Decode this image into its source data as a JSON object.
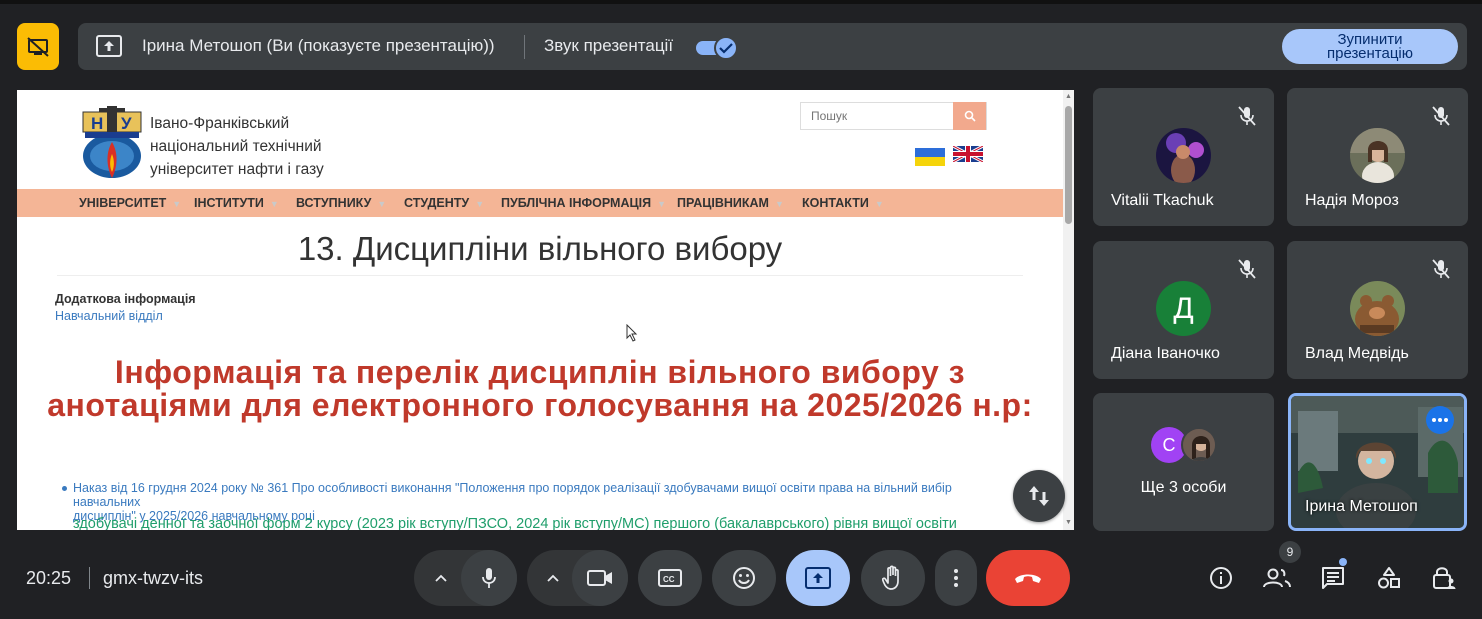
{
  "presentation_bar": {
    "presenter_text": "Ірина Метошоп (Ви (показуєте презентацію))",
    "sound_label": "Звук презентації",
    "sound_on": true,
    "stop_line1": "Зупинити",
    "stop_line2": "презентацію"
  },
  "website": {
    "uni_line1": "Івано-Франківський",
    "uni_line2": "національний технічний",
    "uni_line3": "університет нафти і газу",
    "logo_letters": [
      "Н",
      "У"
    ],
    "search_placeholder": "Пошук",
    "nav": [
      {
        "label": "УНІВЕРСИТЕТ",
        "arrow": "▼"
      },
      {
        "label": "ІНСТИТУТИ",
        "arrow": "▼"
      },
      {
        "label": "ВСТУПНИКУ",
        "arrow": "▼"
      },
      {
        "label": "СТУДЕНТУ",
        "arrow": "▼"
      },
      {
        "label": "ПУБЛІЧНА ІНФОРМАЦІЯ",
        "arrow": "▼"
      },
      {
        "label": "ПРАЦІВНИКАМ",
        "arrow": "▼"
      },
      {
        "label": "КОНТАКТИ",
        "arrow": "▼"
      }
    ],
    "page_title": "13. Дисципліни вільного вибору",
    "additional_info": "Додаткова інформація",
    "department": "Навчальний відділ",
    "heading_line1": "Інформація та перелік дисциплін вільного вибору з",
    "heading_line2": "анотаціями для електронного голосування на 2025/2026 н.р:",
    "order_line1": "Наказ від 16 грудня 2024 року № 361 Про особливості виконання \"Положення про порядок реалізації здобувачами вищої освіти права на вільний вибір навчальних",
    "order_line2": "дисциплін\" у 2025/2026 навчальному році",
    "green_text": "здобувачі денної та заочної форм 2 курсу (2023 рік вступу/ПЗСО, 2024 рік вступу/МС) першого (бакалаврського) рівня вищої освіти"
  },
  "participants": [
    {
      "name": "Vitalii Tkachuk",
      "muted": true
    },
    {
      "name": "Надія Мороз",
      "muted": true
    },
    {
      "name": "Діана Іваночко",
      "muted": true,
      "initial": "Д"
    },
    {
      "name": "Влад Медвідь",
      "muted": true
    }
  ],
  "others": {
    "label": "Ще 3 особи",
    "initial": "С"
  },
  "self": {
    "name": "Ірина Метошоп"
  },
  "bottom_bar": {
    "time": "20:25",
    "meeting_code": "gmx-twzv-its",
    "people_count": "9"
  },
  "colors": {
    "background": "#202124",
    "tile": "#3c4043",
    "accent_blue": "#8ab4f8",
    "share_active": "#a8c7fa",
    "end_call": "#ea4335",
    "present_icon": "#fbbc04",
    "site_nav": "#f4b596",
    "site_heading_red": "#c0392b",
    "site_link_blue": "#3a7abf",
    "site_green": "#1f9e6b"
  },
  "icons": {
    "present_status": "stop-presenting-monitor-icon",
    "share": "present-to-all-icon",
    "mute": "mic-off-icon",
    "swap": "swap-vertical-icon",
    "mic": "mic-icon",
    "camera": "videocam-icon",
    "captions": "closed-caption-icon",
    "reactions": "emoji-icon",
    "present": "present-screen-icon",
    "raise_hand": "hand-icon",
    "more": "more-vert-icon",
    "end_call": "call-end-icon",
    "info": "info-icon",
    "people": "people-icon",
    "chat": "chat-icon",
    "activities": "shapes-icon",
    "host_controls": "lock-person-icon"
  }
}
